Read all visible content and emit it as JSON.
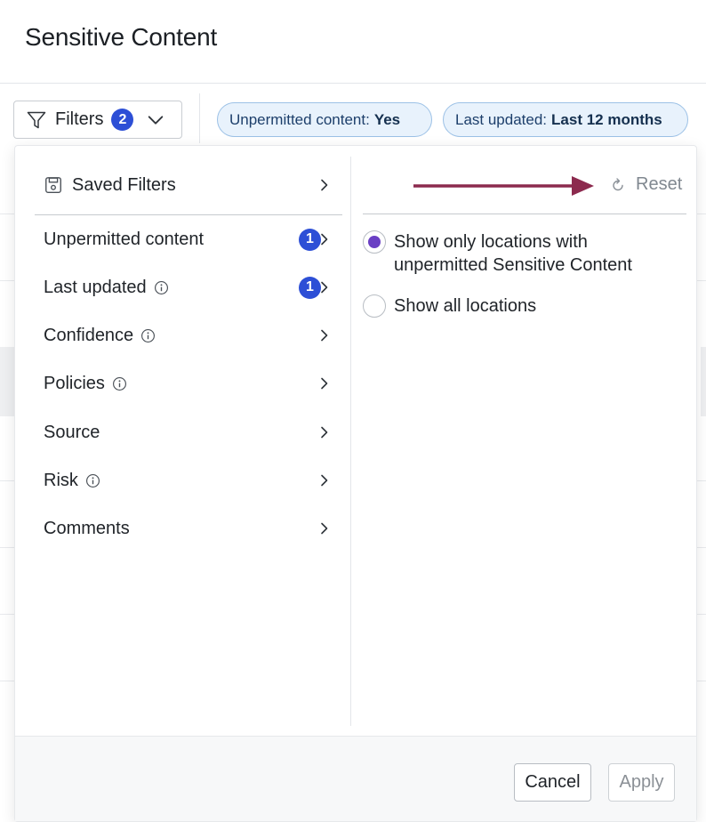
{
  "page": {
    "title": "Sensitive Content"
  },
  "toolbar": {
    "filters_label": "Filters",
    "filters_count": "2",
    "chips": [
      {
        "key": "Unpermitted content:",
        "value": "Yes"
      },
      {
        "key": "Last updated:",
        "value": "Last 12 months"
      }
    ]
  },
  "panel": {
    "saved_filters_label": "Saved Filters",
    "items": [
      {
        "label": "Unpermitted content",
        "badge": "1",
        "info": false
      },
      {
        "label": "Last updated",
        "badge": "1",
        "info": true
      },
      {
        "label": "Confidence",
        "badge": "",
        "info": true
      },
      {
        "label": "Policies",
        "badge": "",
        "info": true
      },
      {
        "label": "Source",
        "badge": "",
        "info": false
      },
      {
        "label": "Risk",
        "badge": "",
        "info": true
      },
      {
        "label": "Comments",
        "badge": "",
        "info": false
      }
    ],
    "reset_label": "Reset",
    "options": [
      {
        "label": "Show only locations with unpermitted Sensitive Content",
        "checked": true
      },
      {
        "label": "Show all locations",
        "checked": false
      }
    ],
    "cancel_label": "Cancel",
    "apply_label": "Apply"
  },
  "colors": {
    "badge": "#2d4fd6",
    "chip_bg": "#e8f2fc",
    "chip_border": "#9cc1e6",
    "radio_selected": "#6a3fc4",
    "annotation_arrow": "#8c2a4e"
  },
  "icons": {
    "filters": "funnel-icon",
    "dropdown": "chevron-down-icon",
    "saved": "floppy-disk-icon",
    "submenu": "chevron-right-icon",
    "info": "info-icon",
    "reset": "refresh-icon"
  }
}
